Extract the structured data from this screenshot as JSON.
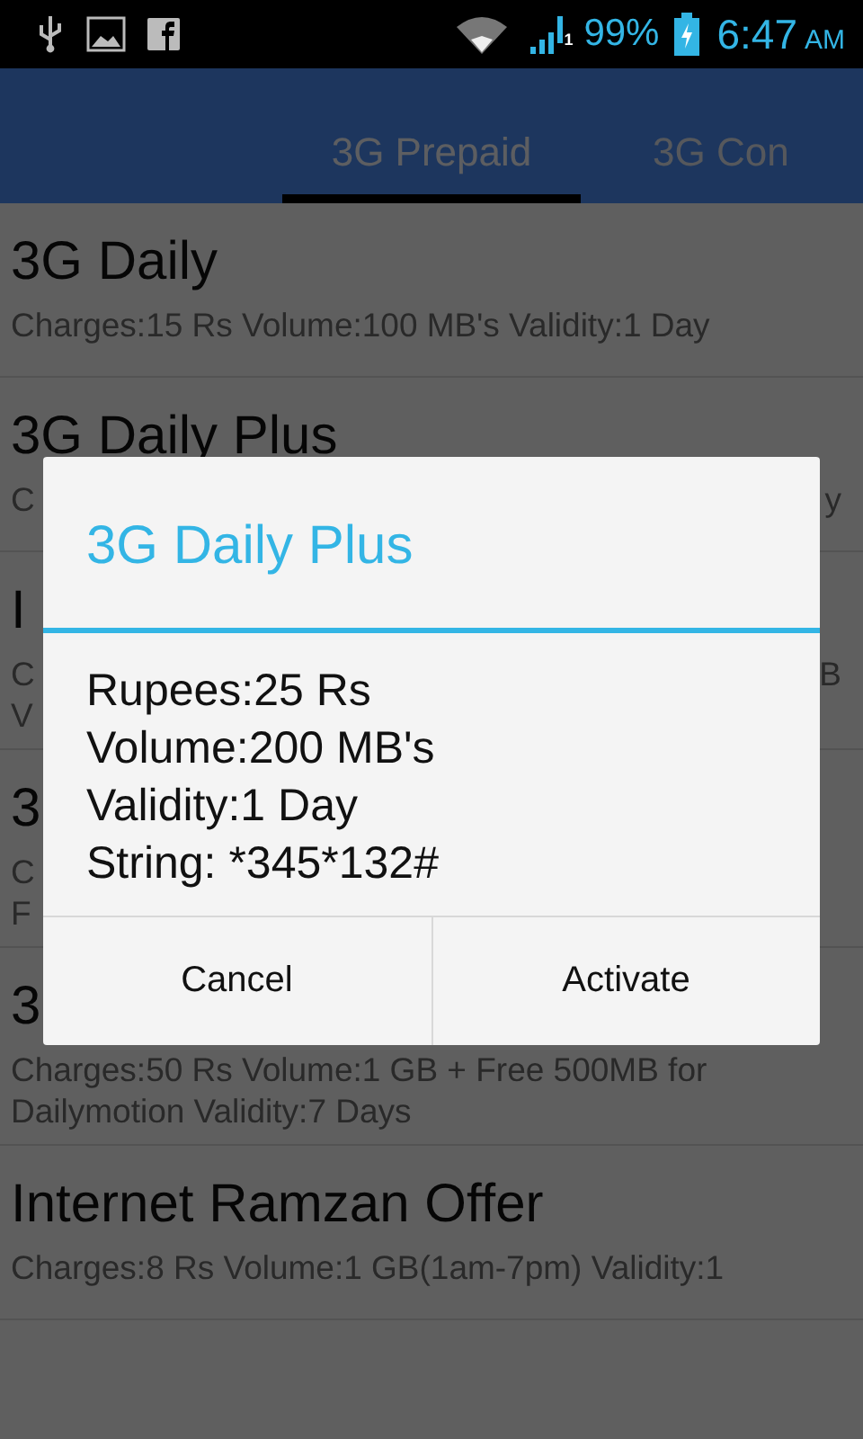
{
  "status_bar": {
    "sim_slot": "1",
    "battery": "99%",
    "time": "6:47",
    "ampm": "AM"
  },
  "tabs": [
    {
      "label": "3G Prepaid",
      "selected": true
    },
    {
      "label": "3G Con",
      "selected": false
    }
  ],
  "plans": [
    {
      "title": "3G Daily",
      "lines": [
        {
          "left": "Charges:15 Rs  Volume:100 MB's Validity:1 Day"
        }
      ]
    },
    {
      "title": "3G Daily Plus",
      "lines": [
        {
          "left": "C",
          "right": "y"
        }
      ]
    },
    {
      "title": "I",
      "lines": [
        {
          "left": "C",
          "right": "B"
        },
        {
          "left": "V"
        }
      ]
    },
    {
      "title": "3",
      "lines": [
        {
          "left": "C"
        },
        {
          "left": "F"
        }
      ]
    },
    {
      "title": "3",
      "lines": [
        {
          "left": "Charges:50 Rs  Volume:1 GB + Free 500MB for"
        },
        {
          "left": "Dailymotion Validity:7 Days"
        }
      ]
    },
    {
      "title": "Internet Ramzan Offer",
      "lines": [
        {
          "left": "Charges:8 Rs  Volume:1 GB(1am-7pm)  Validity:1"
        }
      ]
    }
  ],
  "dialog": {
    "title": "3G Daily Plus",
    "lines": [
      "Rupees:25 Rs",
      "Volume:200 MB's",
      "Validity:1 Day",
      "String: *345*132#"
    ],
    "buttons": [
      "Cancel",
      "Activate"
    ]
  }
}
